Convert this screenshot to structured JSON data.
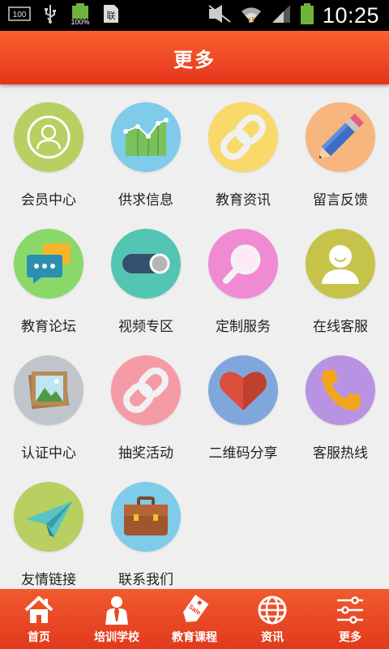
{
  "status_bar": {
    "left_icons": [
      "storage-icon",
      "usb-icon",
      "battery-full-icon",
      "sim-notification-icon"
    ],
    "battery_badge": "100%",
    "storage_badge": "100",
    "right_icons": [
      "mute-icon",
      "wifi-icon",
      "signal-icon",
      "battery-icon"
    ],
    "time": "10:25"
  },
  "header": {
    "title": "更多"
  },
  "grid": {
    "items": [
      {
        "label": "会员中心",
        "icon": "user-outline-icon",
        "color": "#b8cf62"
      },
      {
        "label": "供求信息",
        "icon": "area-chart-icon",
        "color": "#7ecbea"
      },
      {
        "label": "教育资讯",
        "icon": "chain-link-icon",
        "color": "#f8d96a"
      },
      {
        "label": "留言反馈",
        "icon": "pencil-icon",
        "color": "#f6b67d"
      },
      {
        "label": "教育论坛",
        "icon": "chat-bubble-icon",
        "color": "#8ad86a"
      },
      {
        "label": "视频专区",
        "icon": "toggle-switch-icon",
        "color": "#52c6b3"
      },
      {
        "label": "定制服务",
        "icon": "magnifier-icon",
        "color": "#f08ad2"
      },
      {
        "label": "在线客服",
        "icon": "user-avatar-icon",
        "color": "#c6c34a"
      },
      {
        "label": "认证中心",
        "icon": "picture-frame-icon",
        "color": "#c0c5cc"
      },
      {
        "label": "抽奖活动",
        "icon": "chain-link-icon",
        "color": "#f59ba6"
      },
      {
        "label": "二维码分享",
        "icon": "heart-icon",
        "color": "#7fa7dc"
      },
      {
        "label": "客服热线",
        "icon": "phone-icon",
        "color": "#b993e3"
      },
      {
        "label": "友情链接",
        "icon": "paper-plane-icon",
        "color": "#b8cf62"
      },
      {
        "label": "联系我们",
        "icon": "briefcase-icon",
        "color": "#7ecbea"
      }
    ]
  },
  "tab_bar": {
    "tabs": [
      {
        "label": "首页",
        "icon": "home-icon"
      },
      {
        "label": "培训学校",
        "icon": "person-tie-icon"
      },
      {
        "label": "教育课程",
        "icon": "sale-tag-icon",
        "badge": "Sale"
      },
      {
        "label": "资讯",
        "icon": "globe-icon"
      },
      {
        "label": "更多",
        "icon": "sliders-icon"
      }
    ]
  }
}
